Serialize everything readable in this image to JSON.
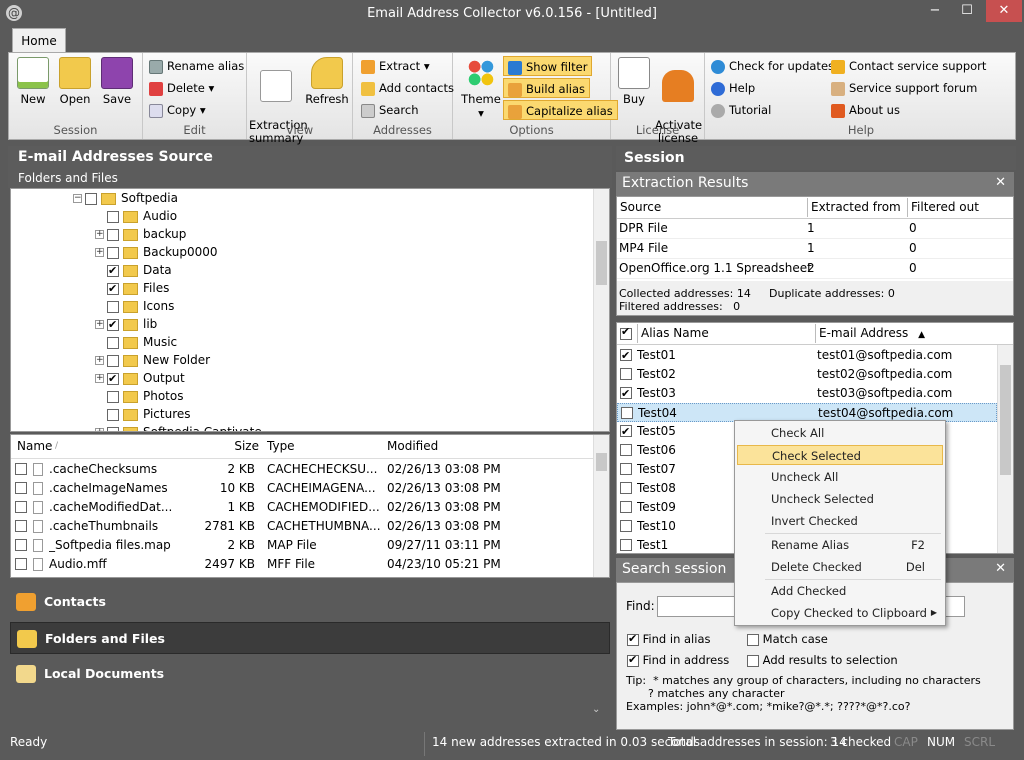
{
  "window": {
    "title": "Email Address Collector v6.0.156 - [Untitled]",
    "minimize": "−",
    "maximize": "☐",
    "close": "✕"
  },
  "ribbon": {
    "tab": "Home",
    "session": {
      "label": "Session",
      "new": "New",
      "open": "Open",
      "save": "Save"
    },
    "edit": {
      "label": "Edit",
      "rename": "Rename alias",
      "delete": "Delete",
      "copy": "Copy"
    },
    "view": {
      "label": "View",
      "extraction_summary": "Extraction\nsummary",
      "refresh": "Refresh"
    },
    "addresses": {
      "label": "Addresses",
      "extract": "Extract",
      "add_contacts": "Add contacts",
      "search": "Search"
    },
    "options": {
      "label": "Options",
      "theme": "Theme",
      "show_filter": "Show filter",
      "build_alias": "Build alias",
      "capitalize_alias": "Capitalize alias"
    },
    "license": {
      "label": "License",
      "buy": "Buy",
      "activate": "Activate\nlicense"
    },
    "help": {
      "label": "Help",
      "check_updates": "Check for updates",
      "help": "Help",
      "tutorial": "Tutorial",
      "contact_support": "Contact service support",
      "support_forum": "Service support forum",
      "about": "About us"
    }
  },
  "left": {
    "title": "E-mail Addresses Source",
    "subtitle": "Folders and Files",
    "tree": [
      {
        "name": "Softpedia",
        "checked": false,
        "expander": "−"
      },
      {
        "name": "Audio",
        "checked": false,
        "expander": ""
      },
      {
        "name": "backup",
        "checked": false,
        "expander": "+"
      },
      {
        "name": "Backup0000",
        "checked": false,
        "expander": "+"
      },
      {
        "name": "Data",
        "checked": true,
        "expander": ""
      },
      {
        "name": "Files",
        "checked": true,
        "expander": ""
      },
      {
        "name": "Icons",
        "checked": false,
        "expander": ""
      },
      {
        "name": "lib",
        "checked": true,
        "expander": "+"
      },
      {
        "name": "Music",
        "checked": false,
        "expander": ""
      },
      {
        "name": "New Folder",
        "checked": false,
        "expander": "+"
      },
      {
        "name": "Output",
        "checked": true,
        "expander": "+"
      },
      {
        "name": "Photos",
        "checked": false,
        "expander": ""
      },
      {
        "name": "Pictures",
        "checked": false,
        "expander": ""
      },
      {
        "name": "Softpedia Captivate",
        "checked": false,
        "expander": "+"
      }
    ],
    "file_columns": [
      "Name",
      "Size",
      "Type",
      "Modified"
    ],
    "files": [
      {
        "name": ".cacheChecksums",
        "size": "2 KB",
        "type": "CACHECHECKSU...",
        "modified": "02/26/13 03:08 PM"
      },
      {
        "name": ".cacheImageNames",
        "size": "10 KB",
        "type": "CACHEIMAGENA...",
        "modified": "02/26/13 03:08 PM"
      },
      {
        "name": ".cacheModifiedDat...",
        "size": "1 KB",
        "type": "CACHEMODIFIED...",
        "modified": "02/26/13 03:08 PM"
      },
      {
        "name": ".cacheThumbnails",
        "size": "2781 KB",
        "type": "CACHETHUMBNA...",
        "modified": "02/26/13 03:08 PM"
      },
      {
        "name": "_Softpedia files.map",
        "size": "2 KB",
        "type": "MAP File",
        "modified": "09/27/11 03:11 PM"
      },
      {
        "name": "Audio.mff",
        "size": "2497 KB",
        "type": "MFF File",
        "modified": "04/23/10 05:21 PM"
      }
    ],
    "nav": {
      "contacts": "Contacts",
      "folders": "Folders and Files",
      "local": "Local Documents"
    }
  },
  "session": {
    "title": "Session",
    "extraction": {
      "title": "Extraction Results",
      "columns": [
        "Source",
        "Extracted from",
        "Filtered out"
      ],
      "rows": [
        {
          "source": "DPR File",
          "extracted": "1",
          "filtered": "0"
        },
        {
          "source": "MP4 File",
          "extracted": "1",
          "filtered": "0"
        },
        {
          "source": "OpenOffice.org 1.1 Spreadsheet",
          "extracted": "2",
          "filtered": "0"
        }
      ],
      "collected": "Collected addresses: 14",
      "duplicate": "Duplicate addresses: 0",
      "filtered": "Filtered addresses:   0"
    },
    "alias_columns": {
      "alias": "Alias Name",
      "email": "E-mail Address"
    },
    "aliases": [
      {
        "alias": "Test01",
        "email": "test01@softpedia.com",
        "checked": true
      },
      {
        "alias": "Test02",
        "email": "test02@softpedia.com",
        "checked": false
      },
      {
        "alias": "Test03",
        "email": "test03@softpedia.com",
        "checked": true
      },
      {
        "alias": "Test04",
        "email": "test04@softpedia.com",
        "checked": false
      },
      {
        "alias": "Test05",
        "email": "",
        "checked": true
      },
      {
        "alias": "Test06",
        "email": "",
        "checked": false
      },
      {
        "alias": "Test07",
        "email": "",
        "checked": false
      },
      {
        "alias": "Test08",
        "email": "",
        "checked": false
      },
      {
        "alias": "Test09",
        "email": "",
        "checked": false
      },
      {
        "alias": "Test10",
        "email": "",
        "checked": false
      },
      {
        "alias": "Test1",
        "email": "",
        "checked": false
      }
    ],
    "search": {
      "title": "Search session",
      "find_label": "Find:",
      "find_value": "",
      "find_in_alias": "Find in alias",
      "match_case": "Match case",
      "find_in_address": "Find in address",
      "add_results": "Add results to selection",
      "tip1": "Tip:  * matches any group of characters, including no characters",
      "tip2": "? matches any character",
      "tip3": "Examples: john*@*.com; *mike?@*.*; ????*@*?.co?"
    }
  },
  "context_menu": {
    "check_all": "Check All",
    "check_selected": "Check Selected",
    "uncheck_all": "Uncheck All",
    "uncheck_selected": "Uncheck Selected",
    "invert_checked": "Invert Checked",
    "rename_alias": "Rename Alias",
    "rename_key": "F2",
    "delete_checked": "Delete Checked",
    "delete_key": "Del",
    "add_checked": "Add Checked",
    "copy_checked": "Copy Checked to Clipboard"
  },
  "status": {
    "ready": "Ready",
    "message": "14 new addresses extracted in 0.03 seconds",
    "total": "Total addresses in session: 14",
    "checked": "3 checked",
    "cap": "CAP",
    "num": "NUM",
    "scrl": "SCRL"
  }
}
